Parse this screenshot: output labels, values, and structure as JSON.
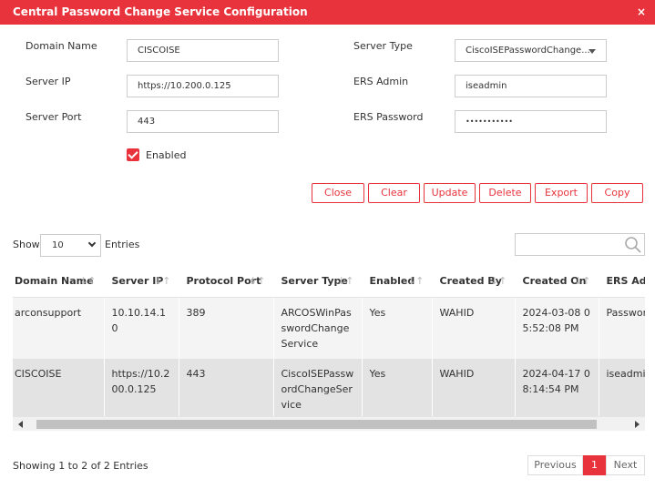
{
  "dialog": {
    "title": "Central Password Change Service Configuration",
    "close_glyph": "×"
  },
  "form": {
    "domain_name": {
      "label": "Domain Name",
      "value": "CISCOISE"
    },
    "server_ip": {
      "label": "Server IP",
      "value": "https://10.200.0.125"
    },
    "server_port": {
      "label": "Server Port",
      "value": "443"
    },
    "server_type": {
      "label": "Server Type",
      "value": "CiscoISEPasswordChange..."
    },
    "ers_admin": {
      "label": "ERS Admin",
      "value": "iseadmin"
    },
    "ers_password": {
      "label": "ERS Password",
      "value": "•••••••••••"
    },
    "enabled": {
      "label": "Enabled",
      "checked": true
    }
  },
  "buttons": {
    "close": "Close",
    "clear": "Clear",
    "update": "Update",
    "delete": "Delete",
    "export": "Export",
    "copy": "Copy"
  },
  "table_controls": {
    "show_label": "Show",
    "page_size": "10",
    "entries_label": "Entries",
    "search_placeholder": ""
  },
  "table": {
    "columns": [
      "Domain Name",
      "Server IP",
      "Protocol Port",
      "Server Type",
      "Enabled",
      "Created By",
      "Created On",
      "ERS Adm"
    ],
    "rows": [
      [
        "arconsupport",
        "10.10.14.10",
        "389",
        "ARCOSWinPasswordChangeService",
        "Yes",
        "WAHID",
        "2024-03-08 05:52:08 PM",
        "Password"
      ],
      [
        "CISCOISE",
        "https://10.200.0.125",
        "443",
        "CiscoISEPasswordChangeService",
        "Yes",
        "WAHID",
        "2024-04-17 08:14:54 PM",
        "iseadmin"
      ]
    ]
  },
  "footer": {
    "info": "Showing 1 to 2 of 2 Entries"
  },
  "pagination": {
    "previous": "Previous",
    "current": "1",
    "next": "Next"
  },
  "colors": {
    "accent": "#e8333c"
  },
  "icons": {
    "search": "search-icon",
    "checkbox": "checkbox-checked-icon",
    "sort": "sort-icon"
  }
}
